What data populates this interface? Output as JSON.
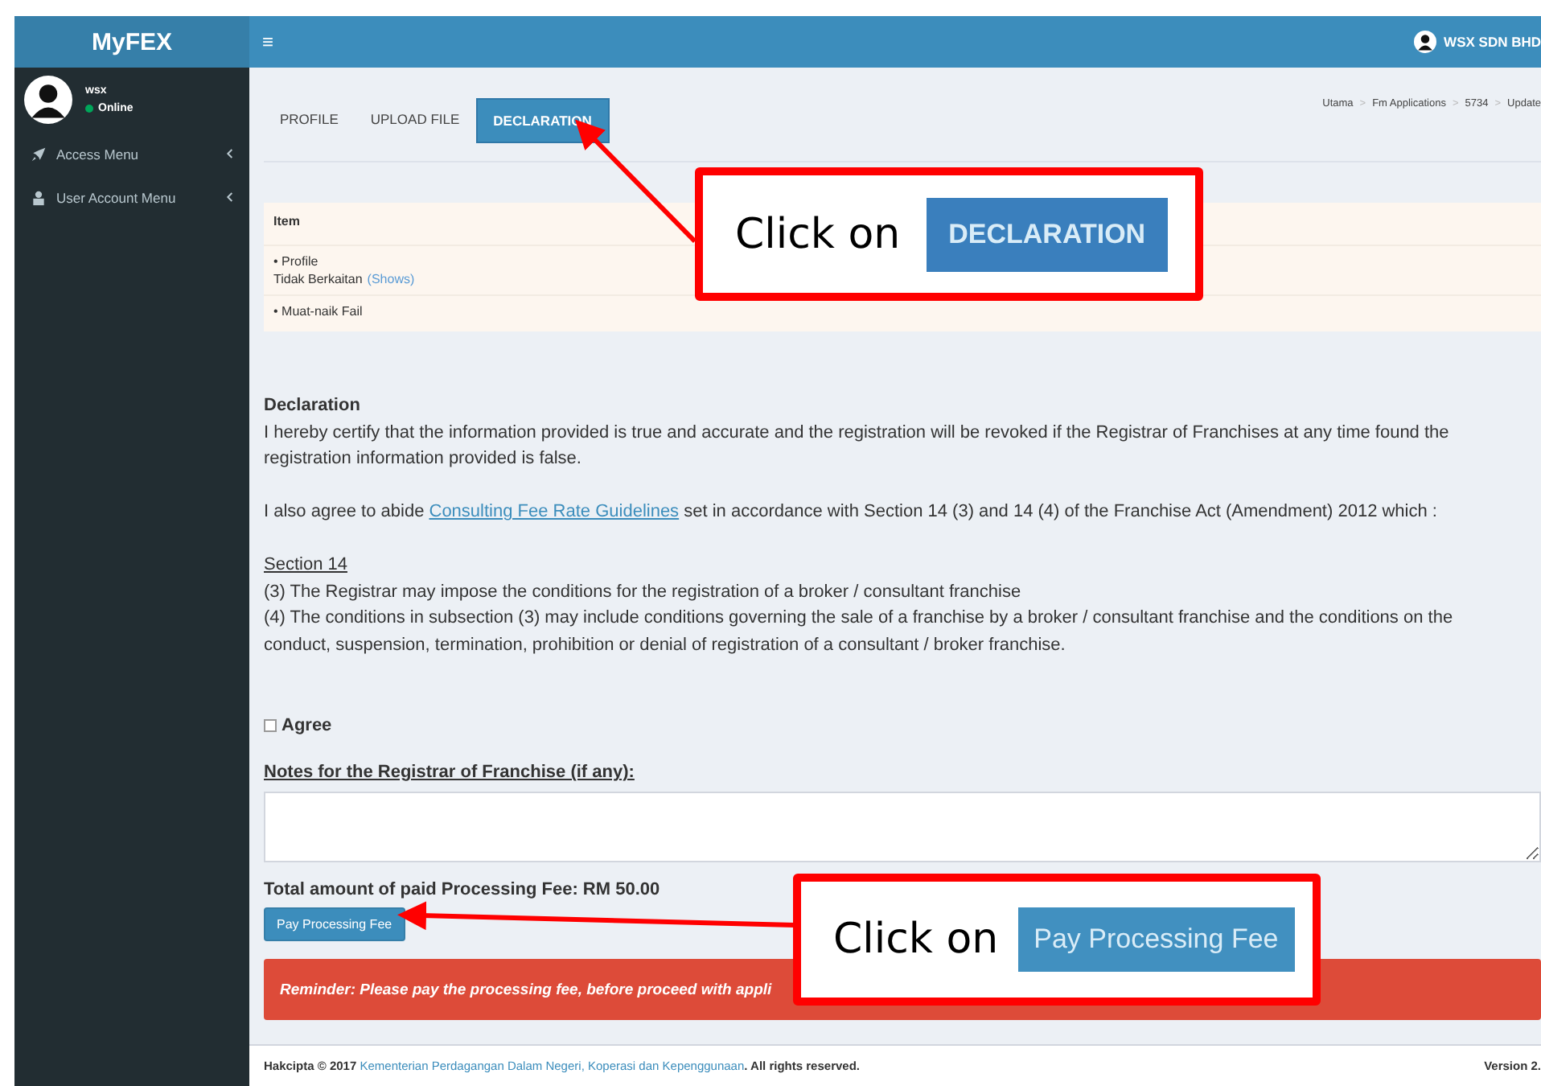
{
  "header": {
    "logo": "MyFEX",
    "menu_toggle": "≡",
    "user_name": "WSX SDN BHD"
  },
  "sidebar": {
    "user": {
      "name": "wsx",
      "status": "Online",
      "online": true
    },
    "items": [
      {
        "label": "Access Menu",
        "kind": "rocket",
        "expanded": false
      },
      {
        "label": "User Account Menu",
        "kind": "user",
        "expanded": false
      }
    ]
  },
  "tabs": [
    {
      "label": "PROFILE",
      "selected": false
    },
    {
      "label": "UPLOAD FILE",
      "selected": false
    },
    {
      "label": "DECLARATION",
      "selected": true
    }
  ],
  "breadcrumb": {
    "separator": ">",
    "items": [
      "Utama",
      "Fm Applications",
      "5734",
      "Update"
    ]
  },
  "table": {
    "header": "Item",
    "rows": [
      {
        "title": "• Profile",
        "status": "Tidak Berkaitan",
        "link": "(Shows)"
      },
      {
        "title": "• Muat-naik Fail"
      }
    ]
  },
  "declaration": {
    "heading": "Declaration",
    "certify": "I hereby certify that the information provided is true and accurate and the registration will be revoked if the Registrar of Franchises at any time found the registration information provided is false.",
    "agree_text": {
      "before": "I also agree to abide ",
      "link": "Consulting Fee Rate Guidelines",
      "after": " set in accordance with Section 14 (3) and 14 (4) of the Franchise Act (Amendment) 2012 which :"
    },
    "section_title": "Section 14",
    "section_lines": [
      "(3) The Registrar may impose the conditions for the registration of a broker / consultant franchise",
      "(4) The conditions in subsection (3) may include conditions governing the sale of a franchise by a broker / consultant franchise and the conditions on the conduct, suspension, termination, prohibition or denial of registration of a consultant / broker franchise."
    ]
  },
  "agree": {
    "label": "Agree",
    "checked": false
  },
  "notes": {
    "label": "Notes for the Registrar of Franchise (if any):"
  },
  "fee": {
    "total": "Total amount of paid Processing Fee: RM 50.00",
    "button": "Pay Processing Fee"
  },
  "reminder": "Reminder: Please pay the processing fee, before proceed with appli",
  "footer": {
    "prefix": "Hakcipta © 2017 ",
    "link": "Kementerian Perdagangan Dalam Negeri, Koperasi dan Kepenggunaan",
    "suffix": ". All rights reserved.",
    "version": "Version 2."
  },
  "callouts": [
    {
      "text": "Click on",
      "button": "DECLARATION"
    },
    {
      "text": "Click on",
      "button": "Pay Processing Fee"
    }
  ]
}
